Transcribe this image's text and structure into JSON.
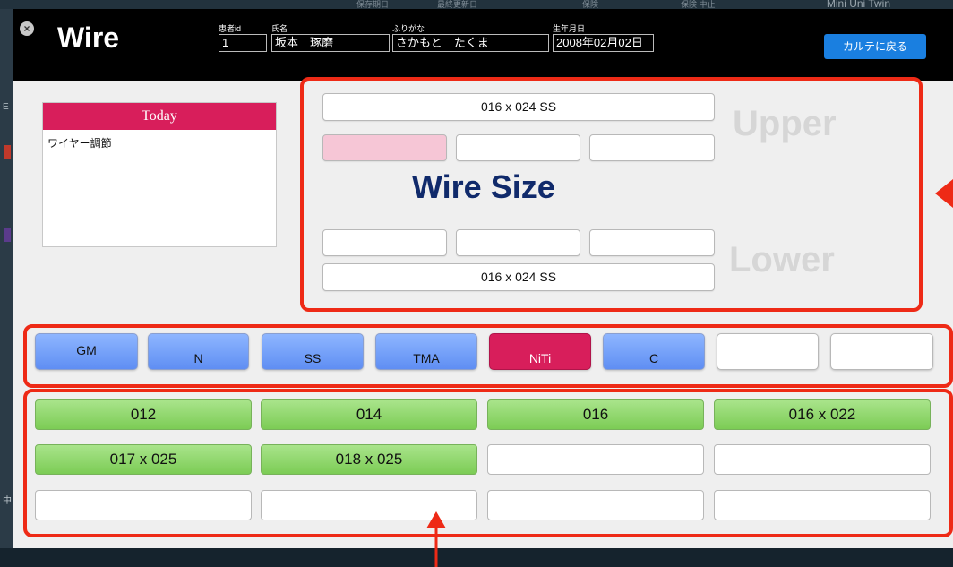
{
  "background": {
    "top_texts": [
      "保存期日",
      "最終更新日",
      "保険",
      "保険 中止"
    ],
    "top_title": "Mini Uni Twin",
    "left_glyphs": [
      "E",
      "中"
    ]
  },
  "header": {
    "title": "Wire",
    "close_symbol": "×",
    "patient_id_label": "患者id",
    "patient_id": "1",
    "name_label": "氏名",
    "name": "坂本　琢磨",
    "kana_label": "ふりがな",
    "kana": "さかもと　たくま",
    "dob_label": "生年月日",
    "dob": "2008年02月02日",
    "back_button": "カルテに戻る"
  },
  "today": {
    "title": "Today",
    "content": "ワイヤー調節"
  },
  "wire_size": {
    "title": "Wire Size",
    "upper_label": "Upper",
    "lower_label": "Lower",
    "upper_value": "016 x 024 SS",
    "lower_value": "016 x 024 SS",
    "upper_slots": [
      "",
      "",
      ""
    ],
    "lower_slots": [
      "",
      "",
      ""
    ]
  },
  "materials": [
    "GM",
    "N",
    "SS",
    "TMA",
    "NiTi",
    "C",
    "",
    ""
  ],
  "selected_material": "NiTi",
  "sizes": [
    "012",
    "014",
    "016",
    "016 x 022",
    "017 x 025",
    "018 x 025",
    "",
    "",
    "",
    "",
    "",
    ""
  ],
  "colors": {
    "accent_pink": "#d81e5b",
    "material_blue": "#6f9cf8",
    "size_green": "#8fd46b",
    "title_navy": "#102a6b",
    "annotation_red": "#ee2a16",
    "back_button_blue": "#1a7fe0"
  }
}
